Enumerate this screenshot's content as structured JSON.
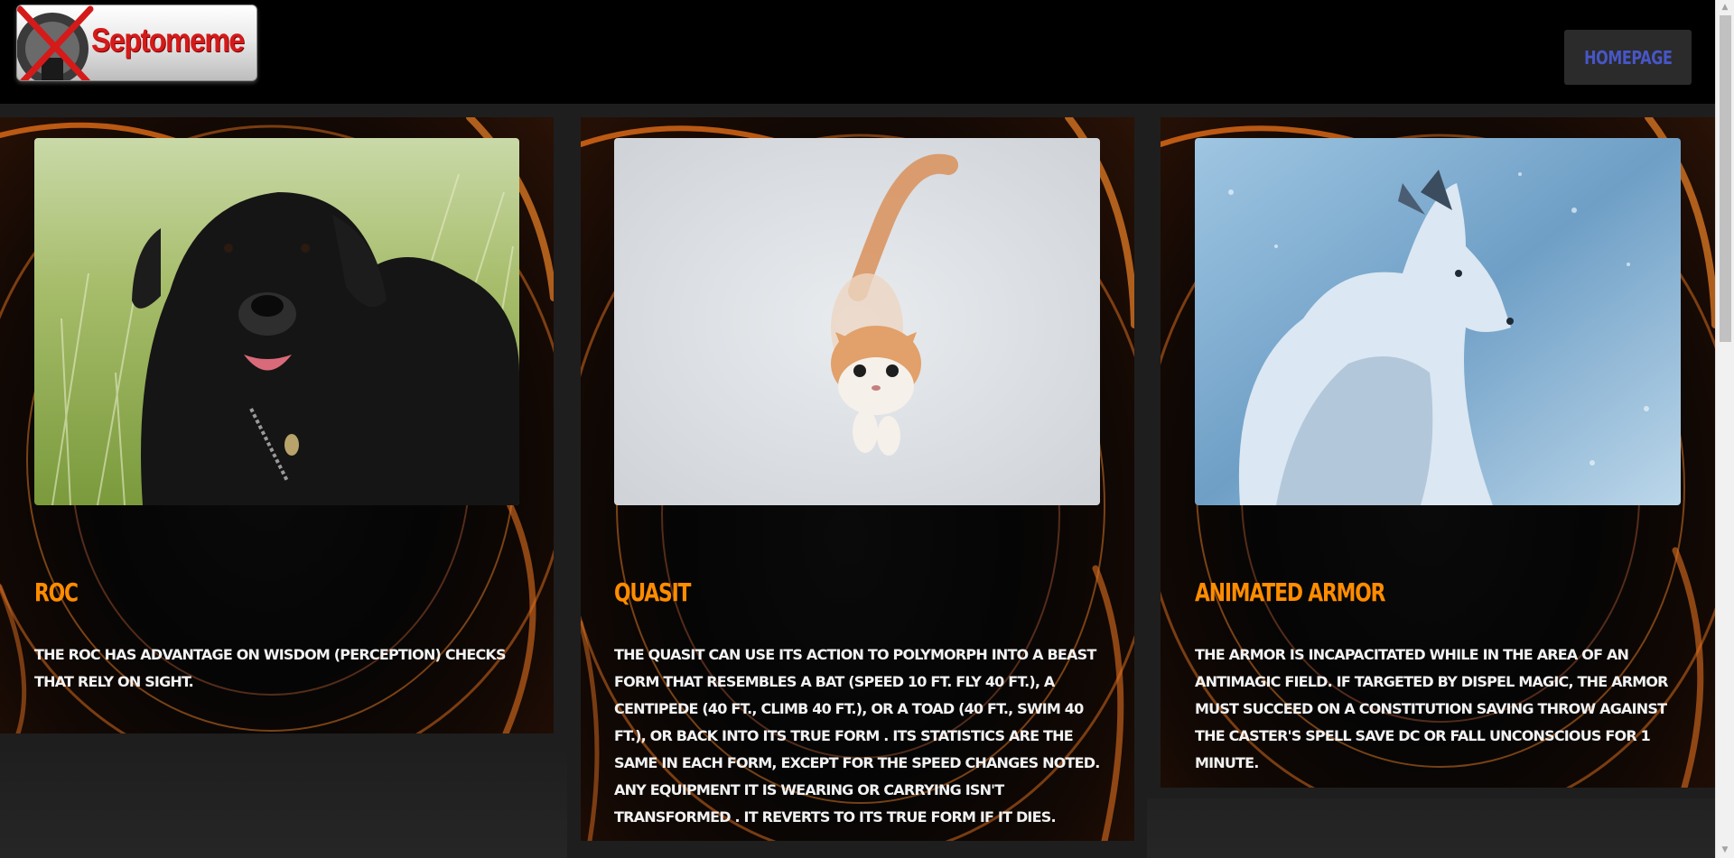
{
  "header": {
    "logo_text": "Septomeme",
    "nav_button_label": "HOMEPAGE"
  },
  "cards": [
    {
      "title": "ROC",
      "image_subject": "black curly dog in grass",
      "description": "THE ROC HAS ADVANTAGE ON WISDOM (PERCEPTION) CHECKS THAT RELY ON SIGHT."
    },
    {
      "title": "QUASIT",
      "image_subject": "orange and white kitten leaping",
      "description": "THE QUASIT CAN USE ITS ACTION TO POLYMORPH INTO A BEAST FORM THAT RESEMBLES A BAT (SPEED 10 FT. FLY 40 FT.), A CENTIPEDE (40 FT., CLIMB 40 FT.), OR A TOAD (40 FT., SWIM 40 FT.), OR BACK INTO ITS TRUE FORM . ITS STATISTICS ARE THE SAME IN EACH FORM, EXCEPT FOR THE SPEED CHANGES NOTED. ANY EQUIPMENT IT IS WEARING OR CARRYING ISN'T TRANSFORMED . IT REVERTS TO ITS TRUE FORM IF IT DIES."
    },
    {
      "title": "ANIMATED ARMOR",
      "image_subject": "arctic fox in snow",
      "description": "THE ARMOR IS INCAPACITATED WHILE IN THE AREA OF AN ANTIMAGIC FIELD. IF TARGETED BY DISPEL MAGIC, THE ARMOR MUST SUCCEED ON A CONSTITUTION SAVING THROW AGAINST THE CASTER'S SPELL SAVE DC OR FALL UNCONSCIOUS FOR 1 MINUTE."
    }
  ],
  "colors": {
    "title": "#ff8c00",
    "button_text": "#4756c6",
    "button_bg": "#2b2b2b",
    "logo_text": "#d51a1a"
  }
}
